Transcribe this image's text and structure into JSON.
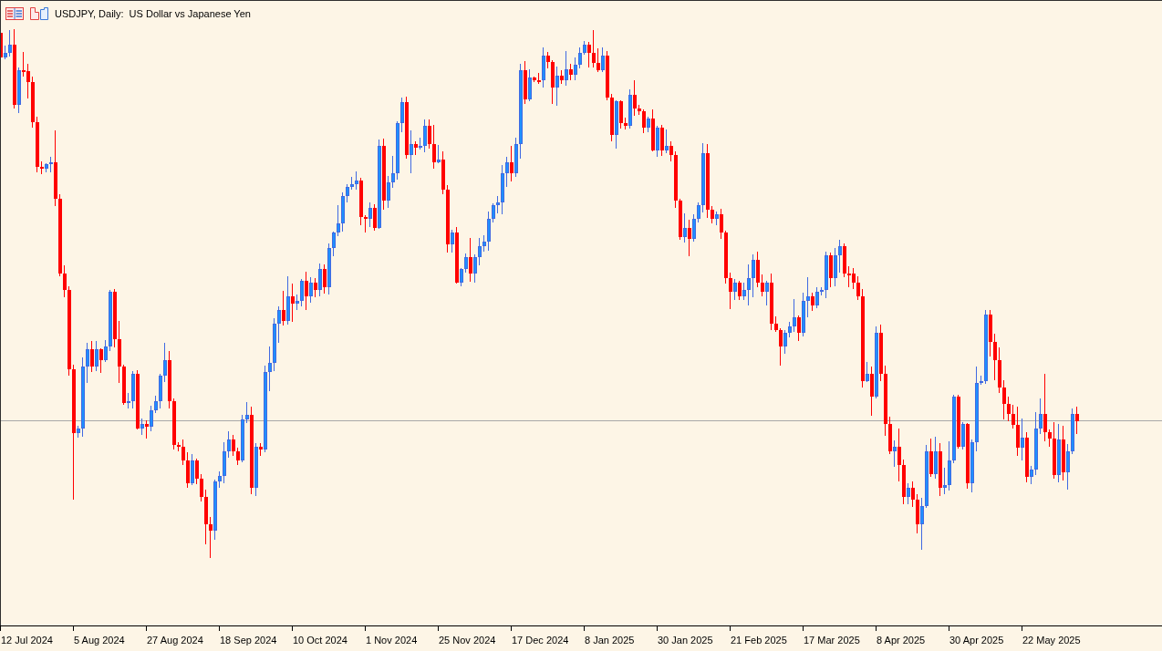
{
  "chart_header": {
    "symbol": "USDJPY, Daily:",
    "description": "US Dollar vs Japanese Yen"
  },
  "time_axis": {
    "labels": [
      "12 Jul 2024",
      "5 Aug 2024",
      "27 Aug 2024",
      "18 Sep 2024",
      "10 Oct 2024",
      "1 Nov 2024",
      "25 Nov 2024",
      "17 Dec 2024",
      "8 Jan 2025",
      "30 Jan 2025",
      "21 Feb 2025",
      "17 Mar 2025",
      "8 Apr 2025",
      "30 Apr 2025",
      "22 May 2025"
    ]
  }
}
